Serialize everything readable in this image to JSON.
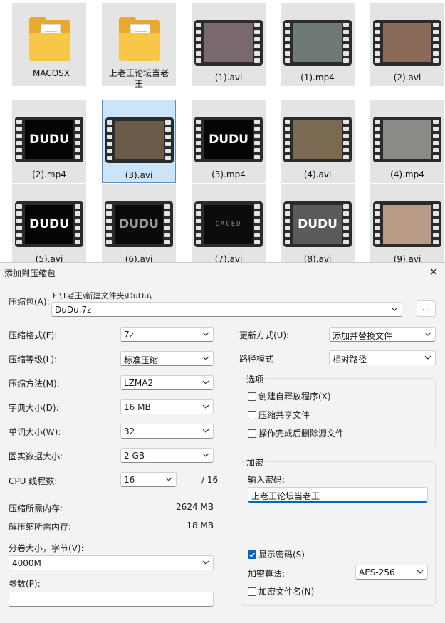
{
  "files": [
    {
      "name": "_MACOSX",
      "type": "folder"
    },
    {
      "name": "上老王论坛当老王",
      "type": "folder"
    },
    {
      "name": "(1).avi",
      "type": "video",
      "thumb": {
        "text": "",
        "bg": "#7a6870"
      }
    },
    {
      "name": "(1).mp4",
      "type": "video",
      "thumb": {
        "text": "",
        "bg": "#6f7a76"
      }
    },
    {
      "name": "(2).avi",
      "type": "video",
      "thumb": {
        "text": "",
        "bg": "#8a6a58"
      }
    },
    {
      "name": "(2).mp4",
      "type": "video",
      "thumb": {
        "text": "DUDU",
        "bg": "#050505"
      }
    },
    {
      "name": "(3).avi",
      "type": "video",
      "thumb": {
        "text": "",
        "bg": "#6a5a48"
      }
    },
    {
      "name": "(3).mp4",
      "type": "video",
      "thumb": {
        "text": "DUDU",
        "bg": "#050505"
      }
    },
    {
      "name": "(4).avi",
      "type": "video",
      "thumb": {
        "text": "",
        "bg": "#7a6a52"
      }
    },
    {
      "name": "(4).mp4",
      "type": "video",
      "thumb": {
        "text": "",
        "bg": "#8a8a86"
      }
    },
    {
      "name": "(5).avi",
      "type": "video",
      "thumb": {
        "text": "DUDU",
        "bg": "#050505"
      }
    },
    {
      "name": "(6).avi",
      "type": "video",
      "thumb": {
        "text": "DUDU",
        "bg": "#0a0a0a"
      }
    },
    {
      "name": "(7).avi",
      "type": "video",
      "thumb": {
        "text": "CAGED",
        "bg": "#0c0c0c"
      }
    },
    {
      "name": "(8).avi",
      "type": "video",
      "thumb": {
        "text": "DUDU",
        "bg": "#5a5a5a"
      }
    },
    {
      "name": "(9).avi",
      "type": "video",
      "thumb": {
        "text": "",
        "bg": "#b99a86"
      }
    }
  ],
  "selected_index": 6,
  "dialog": {
    "title": "添加到压缩包",
    "archive_label": "压缩包(A):",
    "archive_path": "F:\\1老王\\新建文件夹\\DuDu\\",
    "archive_name": "DuDu.7z",
    "browse_label": "...",
    "format_label": "压缩格式(F):",
    "format_value": "7z",
    "level_label": "压缩等级(L):",
    "level_value": "标准压缩",
    "method_label": "压缩方法(M):",
    "method_value": "LZMA2",
    "dict_label": "字典大小(D):",
    "dict_value": "16 MB",
    "word_label": "单词大小(W):",
    "word_value": "32",
    "solid_label": "固实数据大小:",
    "solid_value": "2 GB",
    "cpu_label": "CPU 线程数:",
    "cpu_value": "16",
    "cpu_total": "/ 16",
    "mem_comp_label": "压缩所需内存:",
    "mem_comp_value": "2624 MB",
    "mem_decomp_label": "解压缩所需内存:",
    "mem_decomp_value": "18 MB",
    "volume_label": "分卷大小，字节(V):",
    "volume_value": "4000M",
    "params_label": "参数(P):",
    "params_value": "",
    "update_label": "更新方式(U):",
    "update_value": "添加并替换文件",
    "path_label": "路径模式",
    "path_value": "相对路径",
    "options_title": "选项",
    "opt_sfx": "创建自释放程序(X)",
    "opt_shared": "压缩共享文件",
    "opt_delete": "操作完成后删除源文件",
    "encrypt_title": "加密",
    "password_label": "输入密码:",
    "password_value": "上老王论坛当老王",
    "show_password": "显示密码(S)",
    "encrypt_method_label": "加密算法:",
    "encrypt_method_value": "AES-256",
    "encrypt_names": "加密文件名(N)"
  }
}
